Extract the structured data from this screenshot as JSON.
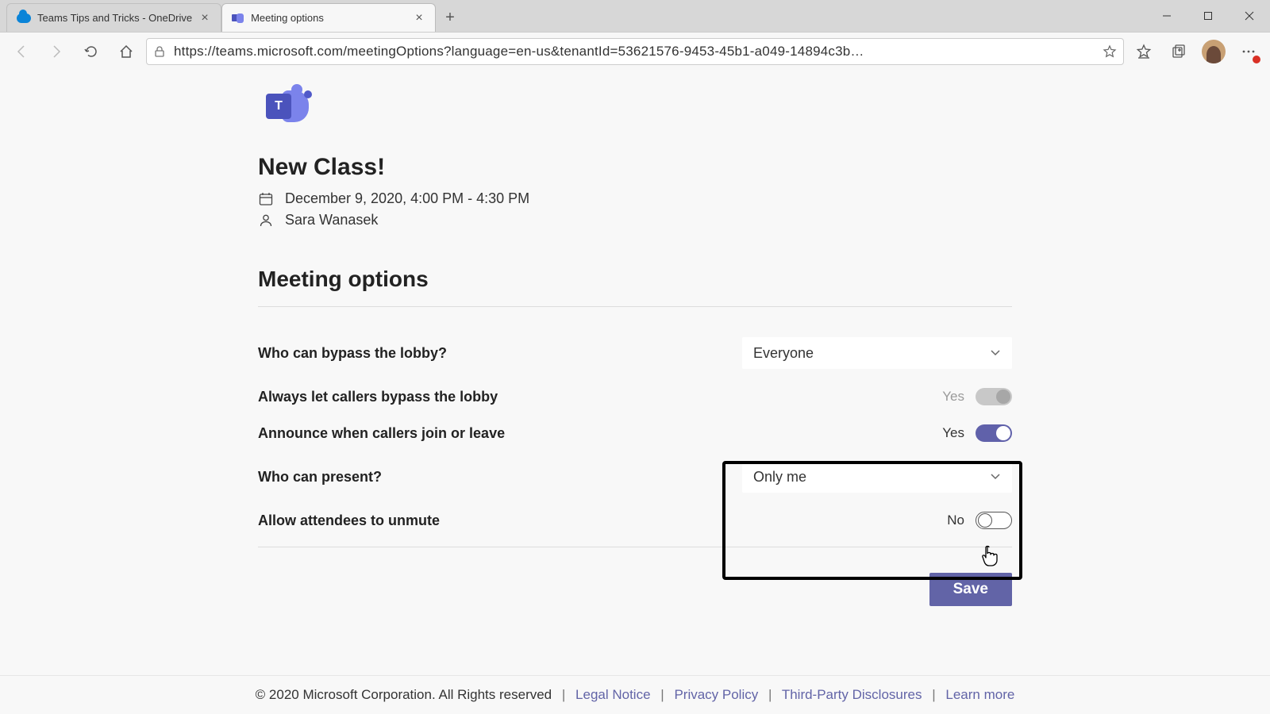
{
  "browser": {
    "tabs": [
      {
        "title": "Teams Tips and Tricks - OneDrive",
        "active": false
      },
      {
        "title": "Meeting options",
        "active": true
      }
    ],
    "url": "https://teams.microsoft.com/meetingOptions?language=en-us&tenantId=53621576-9453-45b1-a049-14894c3b…"
  },
  "logo_letter": "T",
  "meeting": {
    "title": "New Class!",
    "datetime": "December 9, 2020, 4:00 PM - 4:30 PM",
    "organizer": "Sara Wanasek"
  },
  "section_heading": "Meeting options",
  "options": {
    "bypass_lobby": {
      "label": "Who can bypass the lobby?",
      "value": "Everyone"
    },
    "callers_bypass": {
      "label": "Always let callers bypass the lobby",
      "value": "Yes"
    },
    "announce_join_leave": {
      "label": "Announce when callers join or leave",
      "value": "Yes"
    },
    "who_can_present": {
      "label": "Who can present?",
      "value": "Only me"
    },
    "allow_unmute": {
      "label": "Allow attendees to unmute",
      "value": "No"
    }
  },
  "save_label": "Save",
  "footer": {
    "copyright": "© 2020 Microsoft Corporation. All Rights reserved",
    "links": [
      "Legal Notice",
      "Privacy Policy",
      "Third-Party Disclosures",
      "Learn more"
    ]
  }
}
